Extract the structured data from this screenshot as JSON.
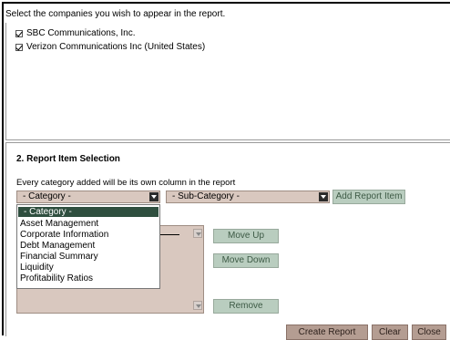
{
  "intro": "Select the companies you wish to appear in the report.",
  "companies": [
    {
      "name": "SBC Communications, Inc.",
      "checked": true
    },
    {
      "name": "Verizon Communications Inc (United States)",
      "checked": true
    }
  ],
  "section2": {
    "title": "2. Report Item Selection",
    "note": "Every category added will be its own column in the report"
  },
  "category_select": {
    "value": "- Category -"
  },
  "subcategory_select": {
    "value": "- Sub-Category -"
  },
  "add_button": "Add Report Item",
  "category_options": [
    "- Category -",
    "Asset Management",
    "Corporate Information",
    "Debt Management",
    "Financial Summary",
    "Liquidity",
    "Profitability Ratios"
  ],
  "buttons": {
    "move_up": "Move Up",
    "move_down": "Move Down",
    "remove": "Remove",
    "create_report": "Create Report",
    "clear": "Clear",
    "close": "Close"
  },
  "colors": {
    "select_bg": "#d9c8bf",
    "green_button": "#b9cdbf",
    "dark_button": "#b49d92",
    "selected_option": "#2f4f3f"
  }
}
